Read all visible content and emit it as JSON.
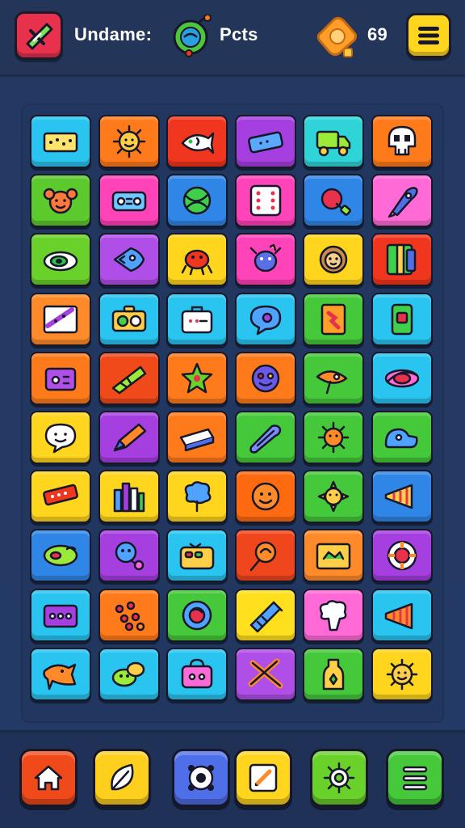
{
  "header": {
    "username_label": "Undame:",
    "pets_label": "Pcts",
    "score": "69"
  },
  "colors": {
    "background": "#243a64",
    "logo_button": "#e8324d",
    "menu_button": "#ffd51e",
    "outline": "#17172a"
  },
  "grid": {
    "rows": 10,
    "columns": 6,
    "tiles": [
      {
        "color": "#29c4ef",
        "icon": "ticket"
      },
      {
        "color": "#ff7a1a",
        "icon": "sun"
      },
      {
        "color": "#f0361e",
        "icon": "fish"
      },
      {
        "color": "#a53fe0",
        "icon": "bandage"
      },
      {
        "color": "#2fd4d8",
        "icon": "truck"
      },
      {
        "color": "#ff7a1a",
        "icon": "skull"
      },
      {
        "color": "#5cc92c",
        "icon": "monkey"
      },
      {
        "color": "#ff43b8",
        "icon": "radio"
      },
      {
        "color": "#2f86e6",
        "icon": "ball"
      },
      {
        "color": "#ff43b8",
        "icon": "dice"
      },
      {
        "color": "#2f86e6",
        "icon": "apple-hand"
      },
      {
        "color": "#ff6ad6",
        "icon": "rocket"
      },
      {
        "color": "#6ad02a",
        "icon": "eye"
      },
      {
        "color": "#b04fe8",
        "icon": "fish-face"
      },
      {
        "color": "#ffd51e",
        "icon": "crab"
      },
      {
        "color": "#ff43b8",
        "icon": "bug"
      },
      {
        "color": "#ffd51e",
        "icon": "lion"
      },
      {
        "color": "#f0361e",
        "icon": "book"
      },
      {
        "color": "#ff8a2a",
        "icon": "paper"
      },
      {
        "color": "#29c4ef",
        "icon": "camera"
      },
      {
        "color": "#29c4ef",
        "icon": "suitcase"
      },
      {
        "color": "#29c4ef",
        "icon": "speech"
      },
      {
        "color": "#45c93a",
        "icon": "card"
      },
      {
        "color": "#29c4ef",
        "icon": "phone"
      },
      {
        "color": "#ff7a1a",
        "icon": "console"
      },
      {
        "color": "#f04a1a",
        "icon": "flag"
      },
      {
        "color": "#ff7a1a",
        "icon": "star"
      },
      {
        "color": "#ff7a1a",
        "icon": "face"
      },
      {
        "color": "#45c93a",
        "icon": "rocket-ship"
      },
      {
        "color": "#29c4ef",
        "icon": "planet"
      },
      {
        "color": "#ffd51e",
        "icon": "chat"
      },
      {
        "color": "#a53fe0",
        "icon": "pencil"
      },
      {
        "color": "#ff7a1a",
        "icon": "eraser"
      },
      {
        "color": "#45c93a",
        "icon": "log"
      },
      {
        "color": "#45c93a",
        "icon": "sun2"
      },
      {
        "color": "#45c93a",
        "icon": "shoe"
      },
      {
        "color": "#ffd51e",
        "icon": "ruler"
      },
      {
        "color": "#ffd51e",
        "icon": "city"
      },
      {
        "color": "#ffd51e",
        "icon": "tree"
      },
      {
        "color": "#ff6a10",
        "icon": "smiley"
      },
      {
        "color": "#45c93a",
        "icon": "sun3"
      },
      {
        "color": "#2f86e6",
        "icon": "horn"
      },
      {
        "color": "#2f86e6",
        "icon": "leaf"
      },
      {
        "color": "#a53fe0",
        "icon": "balloon"
      },
      {
        "color": "#29c4ef",
        "icon": "radio2"
      },
      {
        "color": "#f0461e",
        "icon": "magnify"
      },
      {
        "color": "#ff8a2a",
        "icon": "frame"
      },
      {
        "color": "#a53fe0",
        "icon": "lifebuoy"
      },
      {
        "color": "#29c4ef",
        "icon": "speaker"
      },
      {
        "color": "#ff7a1a",
        "icon": "dots"
      },
      {
        "color": "#45c93a",
        "icon": "globe"
      },
      {
        "color": "#ffe01e",
        "icon": "syringe"
      },
      {
        "color": "#ff6ad6",
        "icon": "broccoli"
      },
      {
        "color": "#29c4ef",
        "icon": "megaphone"
      },
      {
        "color": "#29c4ef",
        "icon": "bird"
      },
      {
        "color": "#29c4ef",
        "icon": "frogs"
      },
      {
        "color": "#29c4ef",
        "icon": "bag"
      },
      {
        "color": "#b04fe8",
        "icon": "scissors"
      },
      {
        "color": "#45c93a",
        "icon": "bottle"
      },
      {
        "color": "#ffd51e",
        "icon": "sunny-face"
      }
    ]
  },
  "bottom_bar": {
    "buttons": [
      {
        "name": "home-button",
        "color": "#f04a1a",
        "icon": "home-icon"
      },
      {
        "name": "leaf-button",
        "color": "#ffcf1e",
        "icon": "leaf-icon"
      },
      {
        "name": "pet-button",
        "color": "#4f6fe8",
        "icon": "pet-face-icon"
      },
      {
        "name": "edit-button",
        "color": "#ffd51e",
        "icon": "edit-icon"
      },
      {
        "name": "settings-button",
        "color": "#6ad02a",
        "icon": "gear-icon"
      },
      {
        "name": "list-button",
        "color": "#45c93a",
        "icon": "list-icon"
      }
    ]
  }
}
